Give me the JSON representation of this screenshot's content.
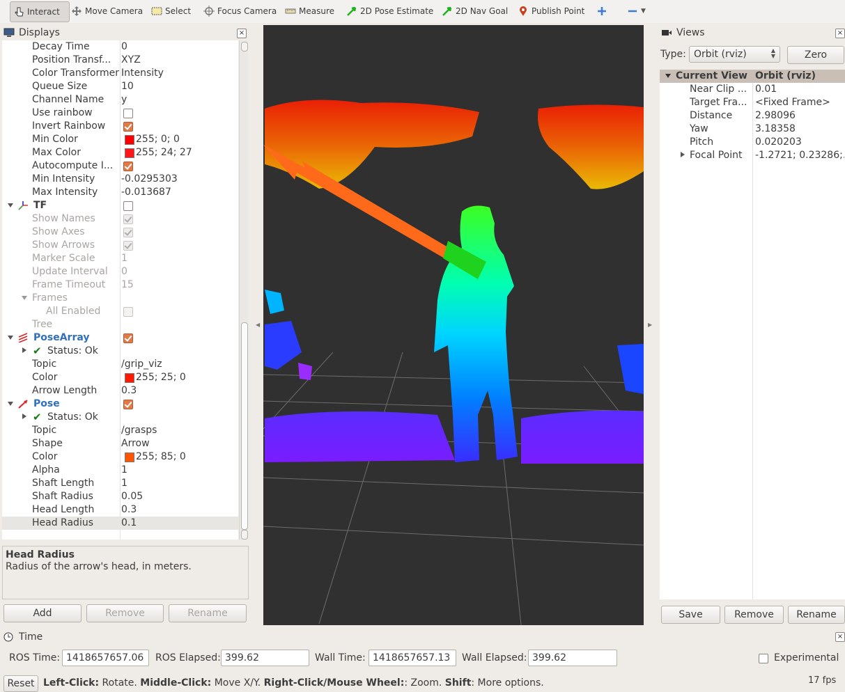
{
  "toolbar": {
    "items": [
      "Interact",
      "Move Camera",
      "Select",
      "Focus Camera",
      "Measure",
      "2D Pose Estimate",
      "2D Nav Goal",
      "Publish Point"
    ]
  },
  "displays": {
    "title": "Displays",
    "close": "×",
    "rows": [
      {
        "name": "Decay Time",
        "value": "0"
      },
      {
        "name": "Position Transf...",
        "value": "XYZ"
      },
      {
        "name": "Color Transformer",
        "value": "Intensity"
      },
      {
        "name": "Queue Size",
        "value": "10"
      },
      {
        "name": "Channel Name",
        "value": "y"
      },
      {
        "name": "Use rainbow",
        "value": ""
      },
      {
        "name": "Invert Rainbow",
        "value": ""
      },
      {
        "name": "Min Color",
        "value": "255; 0; 0"
      },
      {
        "name": "Max Color",
        "value": "255; 24; 27"
      },
      {
        "name": "Autocompute I...",
        "value": ""
      },
      {
        "name": "Min Intensity",
        "value": "-0.0295303"
      },
      {
        "name": "Max Intensity",
        "value": "-0.013687"
      },
      {
        "name": "TF",
        "value": ""
      },
      {
        "name": "Show Names",
        "value": ""
      },
      {
        "name": "Show Axes",
        "value": ""
      },
      {
        "name": "Show Arrows",
        "value": ""
      },
      {
        "name": "Marker Scale",
        "value": "1"
      },
      {
        "name": "Update Interval",
        "value": "0"
      },
      {
        "name": "Frame Timeout",
        "value": "15"
      },
      {
        "name": "Frames",
        "value": ""
      },
      {
        "name": "All Enabled",
        "value": ""
      },
      {
        "name": "Tree",
        "value": ""
      },
      {
        "name": "PoseArray",
        "value": ""
      },
      {
        "name": "Status: Ok",
        "value": ""
      },
      {
        "name": "Topic",
        "value": "/grip_viz"
      },
      {
        "name": "Color",
        "value": "255; 25; 0"
      },
      {
        "name": "Arrow Length",
        "value": "0.3"
      },
      {
        "name": "Pose",
        "value": ""
      },
      {
        "name": "Status: Ok",
        "value": ""
      },
      {
        "name": "Topic",
        "value": "/grasps"
      },
      {
        "name": "Shape",
        "value": "Arrow"
      },
      {
        "name": "Color",
        "value": "255; 85; 0"
      },
      {
        "name": "Alpha",
        "value": "1"
      },
      {
        "name": "Shaft Length",
        "value": "1"
      },
      {
        "name": "Shaft Radius",
        "value": "0.05"
      },
      {
        "name": "Head Length",
        "value": "0.3"
      },
      {
        "name": "Head Radius",
        "value": "0.1"
      }
    ],
    "desc_title": "Head Radius",
    "desc_text": "Radius of the arrow's head, in meters.",
    "buttons": {
      "add": "Add",
      "remove": "Remove",
      "rename": "Rename"
    }
  },
  "colors": {
    "min_color": "#ff0000",
    "max_color": "#ff181b",
    "posearray_color": "#ff1900",
    "pose_color": "#ff5500",
    "checkbox_accent": "#e07a48",
    "link_blue": "#2f6fc0"
  },
  "views": {
    "title": "Views",
    "close": "×",
    "type_label": "Type:",
    "type_value": "Orbit (rviz)",
    "zero": "Zero",
    "header": {
      "name": "Current View",
      "value": "Orbit (rviz)"
    },
    "rows": [
      {
        "name": "Near Clip ...",
        "value": "0.01"
      },
      {
        "name": "Target Fra...",
        "value": "<Fixed Frame>"
      },
      {
        "name": "Distance",
        "value": "2.98096"
      },
      {
        "name": "Yaw",
        "value": "3.18358"
      },
      {
        "name": "Pitch",
        "value": "0.020203"
      },
      {
        "name": "Focal Point",
        "value": "-1.2721; 0.23286;..."
      }
    ],
    "buttons": {
      "save": "Save",
      "remove": "Remove",
      "rename": "Rename"
    }
  },
  "time": {
    "title": "Time",
    "close": "×",
    "ros_time_label": "ROS Time:",
    "ros_time": "1418657657.06",
    "ros_elapsed_label": "ROS Elapsed:",
    "ros_elapsed": "399.62",
    "wall_time_label": "Wall Time:",
    "wall_time": "1418657657.13",
    "wall_elapsed_label": "Wall Elapsed:",
    "wall_elapsed": "399.62",
    "experimental": "Experimental"
  },
  "status": {
    "reset": "Reset",
    "k1": "Left-Click:",
    "v1": " Rotate. ",
    "k2": "Middle-Click:",
    "v2": " Move X/Y. ",
    "k3": "Right-Click/Mouse Wheel:",
    "v3": ": Zoom. ",
    "k4": "Shift",
    "v4": ": More options.",
    "fps": "17 fps"
  }
}
